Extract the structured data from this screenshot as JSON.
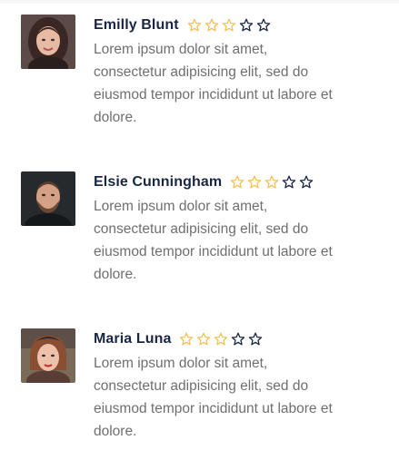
{
  "reviews": [
    {
      "name": "Emilly Blunt",
      "rating": 3,
      "max_rating": 5,
      "text": "Lorem ipsum dolor sit amet, consectetur adipisicing elit, sed do eiusmod tempor incididunt ut labore et dolore."
    },
    {
      "name": "Elsie Cunningham",
      "rating": 3,
      "max_rating": 5,
      "text": "Lorem ipsum dolor sit amet, consectetur adipisicing elit, sed do eiusmod tempor incididunt ut labore et dolore."
    },
    {
      "name": "Maria Luna",
      "rating": 3,
      "max_rating": 5,
      "text": "Lorem ipsum dolor sit amet, consectetur adipisicing elit, sed do eiusmod tempor incididunt ut labore et dolore."
    }
  ],
  "colors": {
    "name": "#1b2642",
    "text": "#6f6f6f",
    "star_filled": "#f3c15a",
    "star_empty": "#1b2642"
  },
  "icons": {
    "star": "star-outline-icon"
  }
}
